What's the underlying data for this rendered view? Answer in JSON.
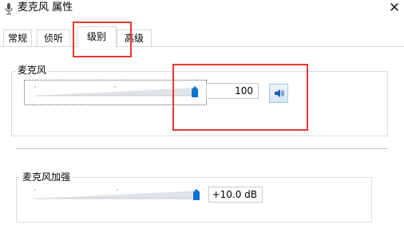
{
  "window": {
    "title": "麦克风 属性",
    "close_icon": "close-icon"
  },
  "tabs": [
    {
      "label": "常规"
    },
    {
      "label": "侦听"
    },
    {
      "label": "级别",
      "active": true
    },
    {
      "label": "高级"
    }
  ],
  "microphone": {
    "legend": "麦克风",
    "value": "100",
    "level": 1.0,
    "mute_icon": "speaker-icon"
  },
  "boost": {
    "legend": "麦克风加强",
    "value": "+10.0 dB",
    "level": 1.0
  },
  "colors": {
    "highlight": "#e53935",
    "thumb": "#0a72d3"
  }
}
